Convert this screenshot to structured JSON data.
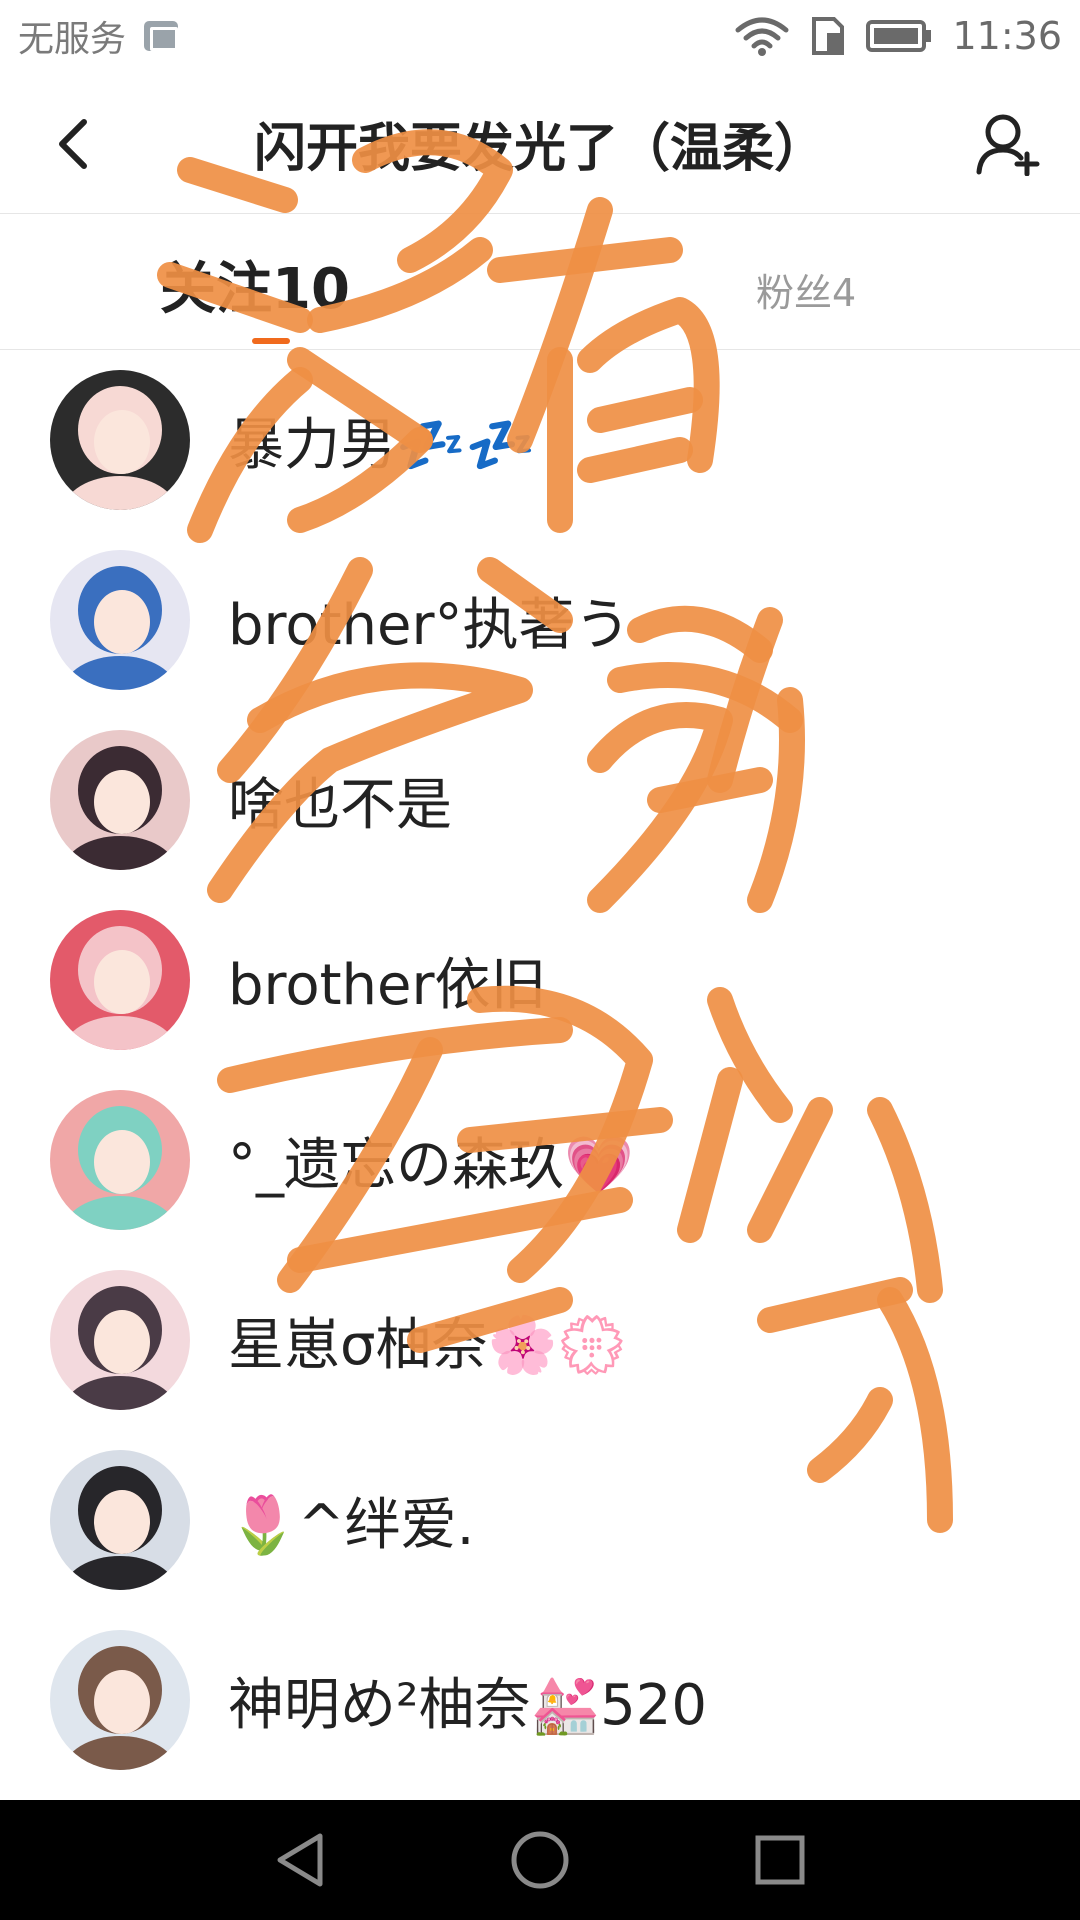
{
  "status_bar": {
    "carrier": "无服务",
    "time": "11:36",
    "icons": [
      "photo-icon",
      "wifi-icon",
      "sim-icon",
      "battery-icon"
    ]
  },
  "header": {
    "title": "闪开我要发光了（温柔）",
    "back_icon": "chevron-left-icon",
    "add_icon": "add-friend-icon"
  },
  "tabs": {
    "following_label": "关注10",
    "fans_label": "粉丝4",
    "accent_color": "#f06a1d"
  },
  "users": [
    {
      "name": "暴力男💤💤",
      "avatar_colors": [
        "#f7d9d4",
        "#2c2c2c"
      ]
    },
    {
      "name": "brother°执著う",
      "avatar_colors": [
        "#3a6fbf",
        "#e6e6f2"
      ]
    },
    {
      "name": "啥也不是",
      "avatar_colors": [
        "#3b2b33",
        "#e9c9c9"
      ]
    },
    {
      "name": "brother依旧",
      "avatar_colors": [
        "#f4c3c8",
        "#e35a6a"
      ]
    },
    {
      "name": "°_遗忘の森玖💗",
      "avatar_colors": [
        "#7fd1c2",
        "#f0a7a7"
      ]
    },
    {
      "name": "星崽σ柚奈🌸💮",
      "avatar_colors": [
        "#4a3b46",
        "#f3d9dd"
      ]
    },
    {
      "name": "🌷^绊爱.",
      "avatar_colors": [
        "#27262a",
        "#d7dde6"
      ]
    },
    {
      "name": "神明め²柚奈💒520",
      "avatar_colors": [
        "#7a5a4a",
        "#dfe6ee"
      ]
    }
  ],
  "overlay": {
    "stroke_color": "#ef8f44",
    "handwritten_text": "没有人能理解我"
  },
  "nav_bar": {
    "buttons": [
      "back-triangle-icon",
      "home-circle-icon",
      "recents-square-icon"
    ]
  }
}
